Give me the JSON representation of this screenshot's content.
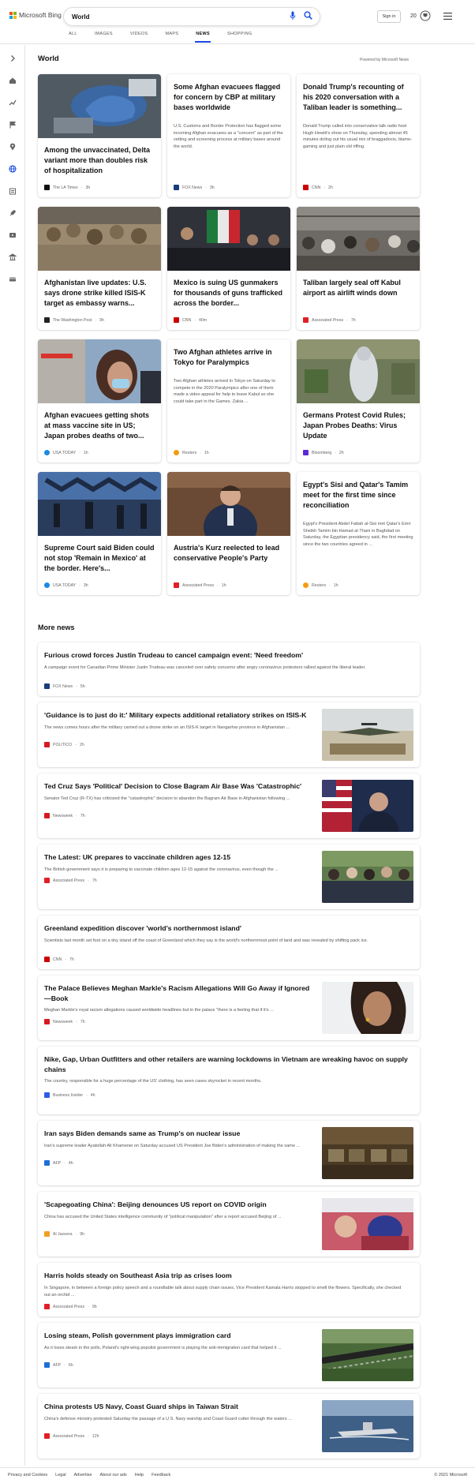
{
  "header": {
    "logo_text": "Microsoft Bing",
    "search_value": "World",
    "sign_in": "Sign in",
    "rewards_count": "20",
    "tabs": [
      "ALL",
      "IMAGES",
      "VIDEOS",
      "MAPS",
      "NEWS",
      "SHOPPING"
    ],
    "active_tab": "NEWS"
  },
  "section": {
    "title": "World",
    "powered_by": "Powered by Microsoft News"
  },
  "top_cards": [
    {
      "title": "Among the unvaccinated, Delta variant more than doubles risk of hospitalization",
      "source": "The LA Times",
      "age": "3h"
    },
    {
      "title": "Some Afghan evacuees flagged for concern by CBP at military bases worldwide",
      "body": "U.S. Customs and Border Protection has flagged some incoming Afghan evacuees as a \"concern\" as part of the vetting and screening process at military bases around the world.",
      "source": "FOX News",
      "age": "3h"
    },
    {
      "title": "Donald Trump's recounting of his 2020 conversation with a Taliban leader is something...",
      "body": "Donald Trump called into conservative talk radio host Hugh Hewitt's show on Thursday, spending almost 45 minutes doling out his usual mix of braggadocio, blame-gaming and just plain old riffing.",
      "source": "CNN",
      "age": "2h"
    },
    {
      "title": "Afghanistan live updates: U.S. says drone strike killed ISIS-K target as embassy warns...",
      "source": "The Washington Post",
      "age": "9h"
    },
    {
      "title": "Mexico is suing US gunmakers for thousands of guns trafficked across the border...",
      "source": "CNN",
      "age": "40m"
    },
    {
      "title": "Taliban largely seal off Kabul airport as airlift winds down",
      "source": "Associated Press",
      "age": "7h"
    },
    {
      "title": "Afghan evacuees getting shots at mass vaccine site in US; Japan probes deaths of two...",
      "source": "USA TODAY",
      "age": "1h"
    },
    {
      "title": "Two Afghan athletes arrive in Tokyo for Paralympics",
      "body": "Two Afghan athletes arrived in Tokyo on Saturday to compete in the 2020 Paralympics after one of them made a video appeal for help to leave Kabul so she could take part in the Games. Zakia ...",
      "source": "Reuters",
      "age": "1h"
    },
    {
      "title": "Germans Protest Covid Rules; Japan Probes Deaths: Virus Update",
      "source": "Bloomberg",
      "age": "2h"
    },
    {
      "title": "Supreme Court said Biden could not stop 'Remain in Mexico' at the border. Here's...",
      "source": "USA TODAY",
      "age": "3h"
    },
    {
      "title": "Austria's Kurz reelected to lead conservative People's Party",
      "source": "Associated Press",
      "age": "1h"
    },
    {
      "title": "Egypt's Sisi and Qatar's Tamim meet for the first time since reconciliation",
      "body": "Egypt's President Abdel Fattah al-Sisi met Qatar's Emir Sheikh Tamim bin Hamad al-Thani in Baghdad on Saturday, the Egyptian presidency said, the first meeting since the two countries agreed in ...",
      "source": "Reuters",
      "age": "1h"
    }
  ],
  "more_news_title": "More news",
  "more_news": [
    {
      "title": "Furious crowd forces Justin Trudeau to cancel campaign event: 'Need freedom'",
      "body": "A campaign event for Canadian Prime Minister Justin Trudeau was canceled over safety concerns after angry coronavirus protesters rallied against the liberal leader.",
      "source": "FOX News",
      "age": "5h"
    },
    {
      "title": "'Guidance is to just do it:' Military expects additional retaliatory strikes on ISIS-K",
      "body": "The news comes hours after the military carried out a drone strike on an ISIS-K target in Nangarhar province in Afghanistan ...",
      "source": "POLITICO",
      "age": "2h"
    },
    {
      "title": "Ted Cruz Says 'Political' Decision to Close Bagram Air Base Was 'Catastrophic'",
      "body": "Senator Ted Cruz (R-TX) has criticized the \"catastrophic\" decision to abandon the Bagram Air Base in Afghanistan following ...",
      "source": "Newsweek",
      "age": "7h"
    },
    {
      "title": "The Latest: UK prepares to vaccinate children ages 12-15",
      "body": "The British government says it is preparing to vaccinate children ages 12-15 against the coronavirus, even though the ...",
      "source": "Associated Press",
      "age": "7h"
    },
    {
      "title": "Greenland expedition discover 'world's northernmost island'",
      "body": "Scientists last month set foot on a tiny island off the coast of Greenland which they say is the world's northernmost point of land and was revealed by shifting pack ice.",
      "source": "CNN",
      "age": "7h"
    },
    {
      "title": "The Palace Believes Meghan Markle's Racism Allegations Will Go Away if Ignored—Book",
      "body": "Meghan Markle's royal racism allegations caused worldwide headlines but in the palace \"there is a feeling that if it's ...",
      "source": "Newsweek",
      "age": "7h"
    },
    {
      "title": "Nike, Gap, Urban Outfitters and other retailers are warning lockdowns in Vietnam are wreaking havoc on supply chains",
      "body": "The country, responsible for a huge percentage of the US' clothing, has seen cases skyrocket in recent months.",
      "source": "Business Insider",
      "age": "4h"
    },
    {
      "title": "Iran says Biden demands same as Trump's on nuclear issue",
      "body": "Iran's supreme leader Ayatollah Ali Khamenei on Saturday accused US President Joe Biden's administration of making the same ...",
      "source": "AFP",
      "age": "4h"
    },
    {
      "title": "'Scapegoating China': Beijing denounces US report on COVID origin",
      "body": "China has accused the United States intelligence community of \"political manipulation\" after a report accused Beijing of ...",
      "source": "Al Jazeera",
      "age": "9h"
    },
    {
      "title": "Harris holds steady on Southeast Asia trip as crises loom",
      "body": "In Singapore, in between a foreign policy speech and a roundtable talk about supply chain issues, Vice President Kamala Harris stopped to smell the flowers. Specifically, she checked out an orchid ...",
      "source": "Associated Press",
      "age": "9h"
    },
    {
      "title": "Losing steam, Polish government plays immigration card",
      "body": "As it loses steam in the polls, Poland's right-wing populist government is playing the anti-immigration card that helped it ...",
      "source": "AFP",
      "age": "6h"
    },
    {
      "title": "China protests US Navy, Coast Guard ships in Taiwan Strait",
      "body": "China's defense ministry protested Saturday the passage of a U.S. Navy warship and Coast Guard cutter through the waters ...",
      "source": "Associated Press",
      "age": "12h"
    }
  ],
  "footer": {
    "links": [
      "Privacy and Cookies",
      "Legal",
      "Advertise",
      "About our ads",
      "Help",
      "Feedback"
    ],
    "copyright": "© 2021 Microsoft"
  },
  "colors": {
    "accent": "#174ae4",
    "microsoft_red": "#f25022",
    "microsoft_green": "#7fba00",
    "microsoft_blue": "#00a4ef",
    "microsoft_yellow": "#ffb900"
  }
}
